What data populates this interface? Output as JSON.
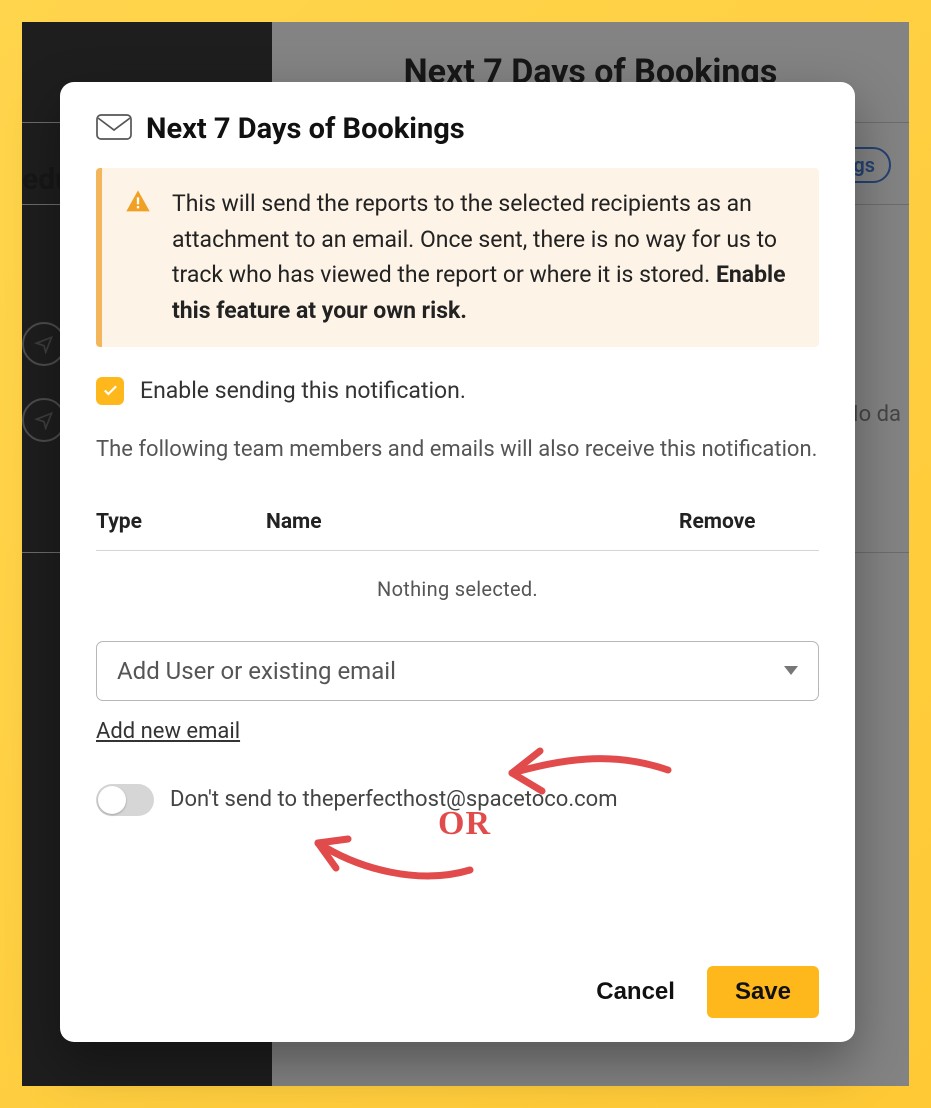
{
  "background": {
    "page_title": "Next 7 Days of Bookings",
    "sidebar_partial": "edu",
    "pill_label": "gs",
    "nodata": "No da"
  },
  "modal": {
    "title": "Next 7 Days of Bookings",
    "alert": {
      "text": "This will send the reports to the selected recipients as an attachment to an email. Once sent, there is no way for us to track who has viewed the report or where it is stored.",
      "strong": "Enable this feature at your own risk."
    },
    "enable_label": "Enable sending this notification.",
    "desc": "The following team members and emails will also receive this notification.",
    "table": {
      "col_type": "Type",
      "col_name": "Name",
      "col_remove": "Remove",
      "empty": "Nothing selected."
    },
    "select_placeholder": "Add User or existing email",
    "add_email_link": "Add new email",
    "toggle_label": "Don't send to theperfecthost@spacetoco.com",
    "cancel": "Cancel",
    "save": "Save"
  },
  "annotation": {
    "or": "OR"
  }
}
